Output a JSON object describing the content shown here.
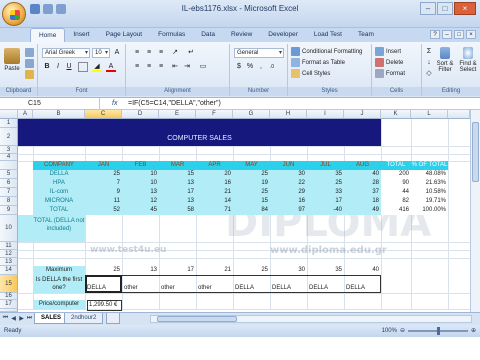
{
  "window": {
    "title": "IL-ebs1176.xlsx - Microsoft Excel"
  },
  "tabs": [
    "Home",
    "Insert",
    "Page Layout",
    "Formulas",
    "Data",
    "Review",
    "Developer",
    "Load Test",
    "Team"
  ],
  "ribbon": {
    "clipboard": {
      "paste": "Paste",
      "label": "Clipboard"
    },
    "font": {
      "name": "Arial Greek",
      "size": "10",
      "label": "Font"
    },
    "alignment": {
      "label": "Alignment"
    },
    "number": {
      "format": "General",
      "label": "Number"
    },
    "styles": {
      "conditional": "Conditional Formatting",
      "table": "Format as Table",
      "cell": "Cell Styles",
      "label": "Styles"
    },
    "cells": {
      "insert": "Insert",
      "delete": "Delete",
      "format": "Format",
      "label": "Cells"
    },
    "editing": {
      "sort": "Sort & Filter",
      "find": "Find & Select",
      "label": "Editing"
    }
  },
  "formula_bar": {
    "name_box": "C15",
    "fx": "fx",
    "formula": "=IF(C5=C14,\"DELLA\",\"other\")"
  },
  "columns": [
    "A",
    "B",
    "C",
    "D",
    "E",
    "F",
    "G",
    "H",
    "I",
    "J",
    "K",
    "L"
  ],
  "rows": [
    "1",
    "2",
    "3",
    "4",
    "5",
    "6",
    "7",
    "8",
    "9",
    "10",
    "11",
    "12",
    "13",
    "14",
    "15",
    "16",
    "17",
    "18"
  ],
  "sheet": {
    "title": "COMPUTER SALES",
    "header": {
      "company": "COMPANY",
      "months": [
        "JAN",
        "FEB",
        "MAR",
        "APR",
        "MAY",
        "JUN",
        "JUL",
        "AUG"
      ],
      "total": "TOTAL",
      "pct": "% OF TOTAL"
    },
    "data": [
      {
        "company": "DELLA",
        "vals": [
          "25",
          "10",
          "15",
          "20",
          "25",
          "30",
          "35",
          "40"
        ],
        "total": "200",
        "pct": "48.08%"
      },
      {
        "company": "HPA",
        "vals": [
          "7",
          "10",
          "13",
          "16",
          "19",
          "22",
          "25",
          "28"
        ],
        "total": "90",
        "pct": "21.63%"
      },
      {
        "company": "IL-com",
        "vals": [
          "9",
          "13",
          "17",
          "21",
          "25",
          "29",
          "33",
          "37"
        ],
        "total": "44",
        "pct": "10.58%"
      },
      {
        "company": "MICRONA",
        "vals": [
          "11",
          "12",
          "13",
          "14",
          "15",
          "16",
          "17",
          "18"
        ],
        "total": "82",
        "pct": "19.71%"
      },
      {
        "company": "TOTAL",
        "vals": [
          "52",
          "45",
          "58",
          "71",
          "84",
          "97",
          "-40",
          "49"
        ],
        "total": "416",
        "pct": "100.00%"
      }
    ],
    "total_label": "TOTAL (DELLA not included)",
    "max_label": "Maximum",
    "max_vals": [
      "25",
      "13",
      "17",
      "21",
      "25",
      "30",
      "35",
      "40"
    ],
    "is_della_label": "Is DELLA the first one?",
    "is_della_vals": [
      "DELLA",
      "other",
      "other",
      "other",
      "DELLA",
      "DELLA",
      "DELLA",
      "DELLA"
    ],
    "price_label": "Price/computer",
    "price_value": "1,299.50 €"
  },
  "sheet_tabs": [
    "SALES",
    "2ndhour2"
  ],
  "status": {
    "ready": "Ready",
    "zoom": "100%"
  },
  "watermarks": [
    "test4u",
    "DIPLOMA",
    "www.test4u.eu",
    "www.diploma.edu.gr"
  ]
}
